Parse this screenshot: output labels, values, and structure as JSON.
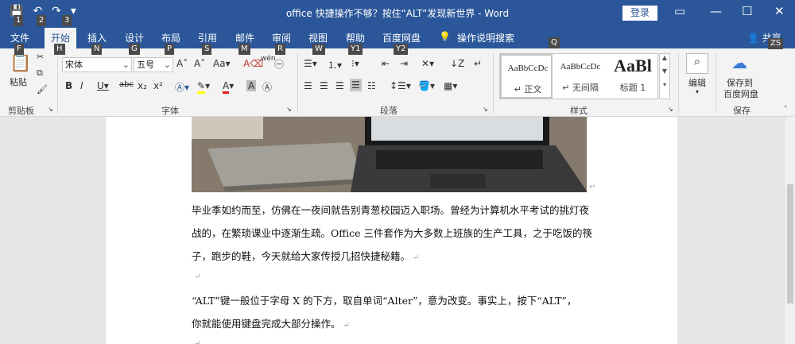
{
  "window": {
    "title": "office 快捷操作不够？按住“ALT”发现新世界  -  Word",
    "login_label": "登录",
    "controls": {
      "ribbon_display": "▭",
      "minimize": "—",
      "maximize": "☐",
      "close": "✕"
    }
  },
  "qat": {
    "save_icon": "💾",
    "undo_icon": "↶",
    "redo_icon": "↷",
    "customize_icon": "▾"
  },
  "tabs": [
    {
      "label": "文件",
      "keytip": "F"
    },
    {
      "label": "开始",
      "keytip": "H"
    },
    {
      "label": "插入",
      "keytip": "N"
    },
    {
      "label": "设计",
      "keytip": "G"
    },
    {
      "label": "布局",
      "keytip": "P"
    },
    {
      "label": "引用",
      "keytip": "S"
    },
    {
      "label": "邮件",
      "keytip": "M"
    },
    {
      "label": "审阅",
      "keytip": "R"
    },
    {
      "label": "视图",
      "keytip": "W"
    },
    {
      "label": "帮助",
      "keytip": "Y1"
    },
    {
      "label": "百度网盘",
      "keytip": "Y2"
    },
    {
      "label": "操作说明搜索",
      "keytip": "Q"
    }
  ],
  "share": {
    "label": "共享",
    "keytip": "ZS"
  },
  "qat_keytips": [
    "1",
    "2",
    "3"
  ],
  "ribbon": {
    "clipboard": {
      "paste_label": "粘贴",
      "group_label": "剪贴板"
    },
    "font": {
      "font_name": "宋体",
      "font_size": "五号",
      "group_label": "字体",
      "aa_label": "Aa",
      "wen_label": "wén"
    },
    "paragraph": {
      "group_label": "段落"
    },
    "styles": {
      "group_label": "样式",
      "items": [
        {
          "sample": "AaBbCcDc",
          "name": "↵ 正文"
        },
        {
          "sample": "AaBbCcDc",
          "name": "↵ 无间隔"
        },
        {
          "sample": "AaBl",
          "name": "标题 1"
        }
      ]
    },
    "editing": {
      "label": "编辑"
    },
    "save": {
      "label1": "保存到",
      "label2": "百度网盘",
      "group_label": "保存"
    }
  },
  "document": {
    "paragraphs": [
      "毕业季如约而至，仿佛在一夜间就告别青葱校园迈入职场。曾经为计算机水平考试的挑灯夜",
      "战的，在繁琐课业中逐渐生疏。Office 三件套作为大多数上班族的生产工具，之于吃饭的筷",
      "子，跑步的鞋，今天就给大家传授几招快捷秘籍。",
      "",
      "“ALT”键一般位于字母 X 的下方，取自单词“Alter”，意为改变。事实上，按下“ALT”，",
      "你就能使用键盘完成大部分操作。",
      ""
    ],
    "pilcrow": "↵"
  }
}
